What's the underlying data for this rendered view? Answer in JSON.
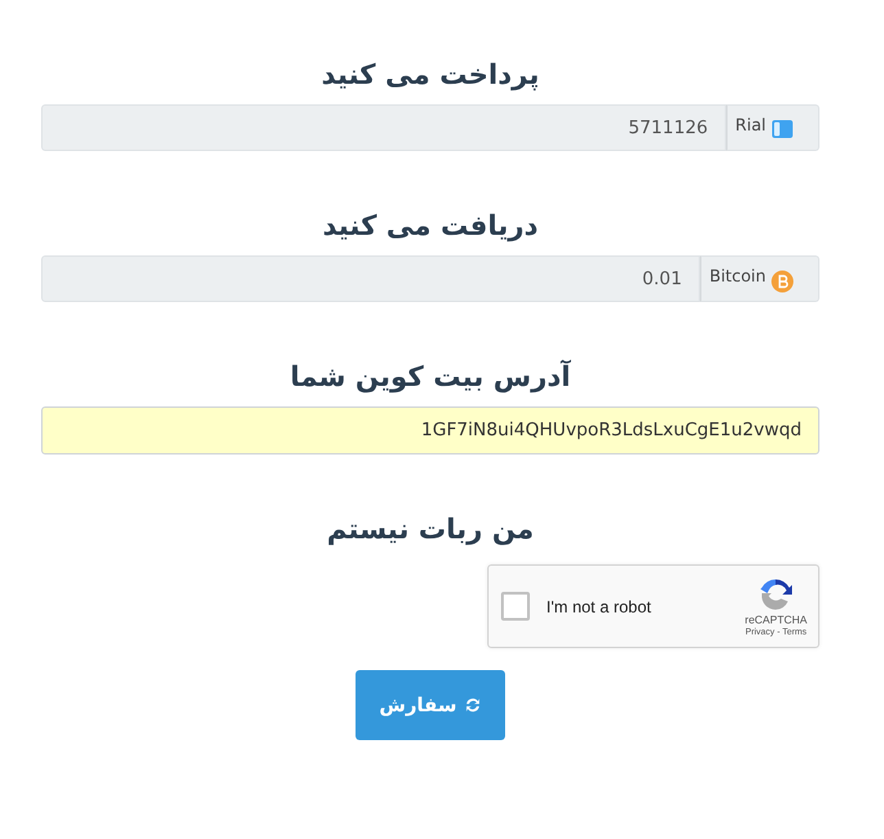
{
  "amounts": [
    {
      "title": "پرداخت می کنید",
      "value": "5711126",
      "currency": "Rial",
      "kind": "rial"
    },
    {
      "title": "دریافت می کنید",
      "value": "0.01",
      "currency": "Bitcoin",
      "kind": "bitcoin"
    }
  ],
  "address": {
    "title": "آدرس بیت کوین شما",
    "value": "1GF7iN8ui4QHUvpoR3LdsLxuCgE1u2vwqd"
  },
  "captcha": {
    "title": "من ربات نیستم",
    "label": "I'm not a robot",
    "brand": "reCAPTCHA",
    "links": "Privacy - Terms",
    "checked": false
  },
  "submit": {
    "label": "سفارش"
  }
}
